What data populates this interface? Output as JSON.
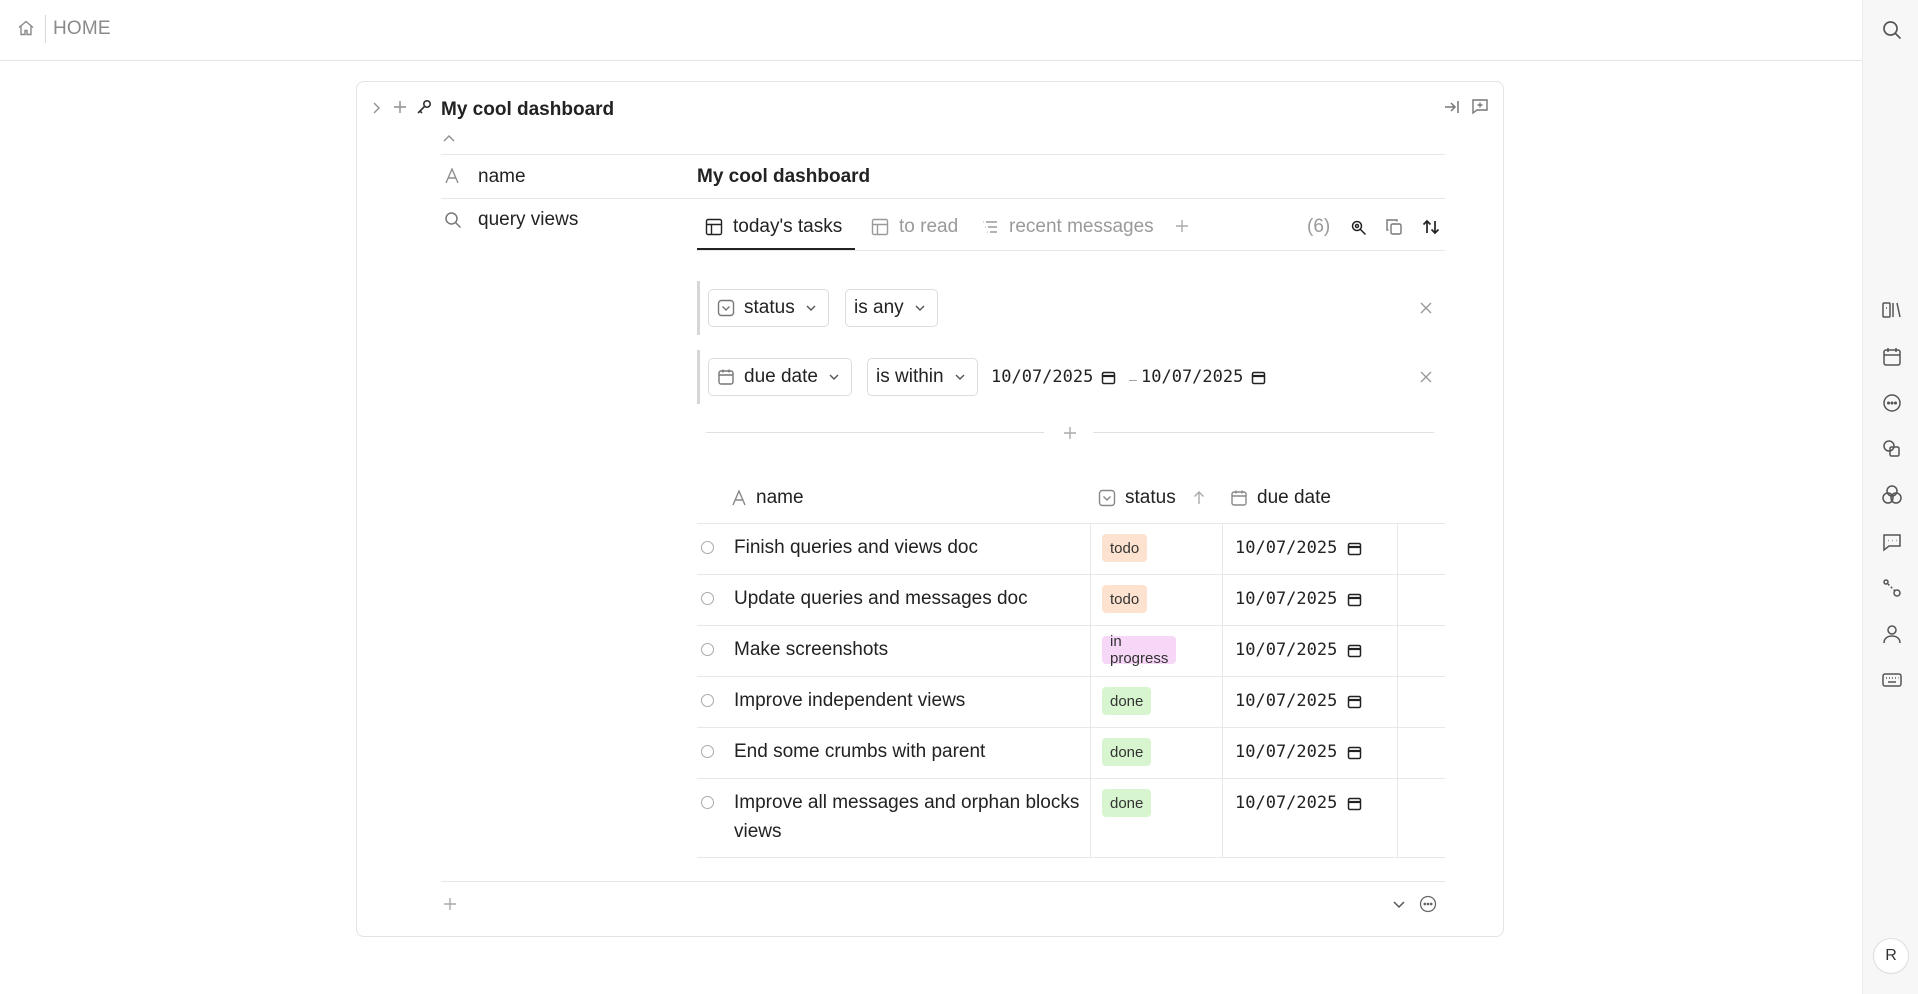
{
  "topbar": {
    "home_label": "HOME",
    "home_icon": "house-icon"
  },
  "dashboard": {
    "title": "My cool dashboard",
    "properties": [
      {
        "icon": "text-type-icon",
        "label": "name",
        "value": "My cool dashboard"
      },
      {
        "icon": "search-icon",
        "label": "query views"
      }
    ],
    "tabs": [
      {
        "icon": "table-icon",
        "label": "today's tasks",
        "active": true
      },
      {
        "icon": "table-icon",
        "label": "to read",
        "active": false
      },
      {
        "icon": "list-icon",
        "label": "recent messages",
        "active": false
      }
    ],
    "result_count": "(6)",
    "filters": [
      {
        "field": "status",
        "operator": "is any"
      },
      {
        "field": "due date",
        "operator": "is within",
        "from": "10/07/2025",
        "separator": "–",
        "to": "10/07/2025"
      }
    ],
    "columns": {
      "name": "name",
      "status": "status",
      "due_date": "due date"
    },
    "rows": [
      {
        "name": "Finish queries and views doc",
        "status": "todo",
        "due": "10/07/2025"
      },
      {
        "name": "Update queries and messages doc",
        "status": "todo",
        "due": "10/07/2025"
      },
      {
        "name": "Make screenshots",
        "status": "in progress",
        "due": "10/07/2025"
      },
      {
        "name": "Improve independent views",
        "status": "done",
        "due": "10/07/2025"
      },
      {
        "name": "End some crumbs with parent",
        "status": "done",
        "due": "10/07/2025"
      },
      {
        "name": "Improve all messages and orphan blocks views",
        "status": "done",
        "due": "10/07/2025"
      }
    ]
  },
  "status_colors": {
    "todo": "#fde3cf",
    "in progress": "#f6d7f7",
    "done": "#d7f5cf"
  },
  "sidebar": {
    "avatar_initial": "R"
  }
}
